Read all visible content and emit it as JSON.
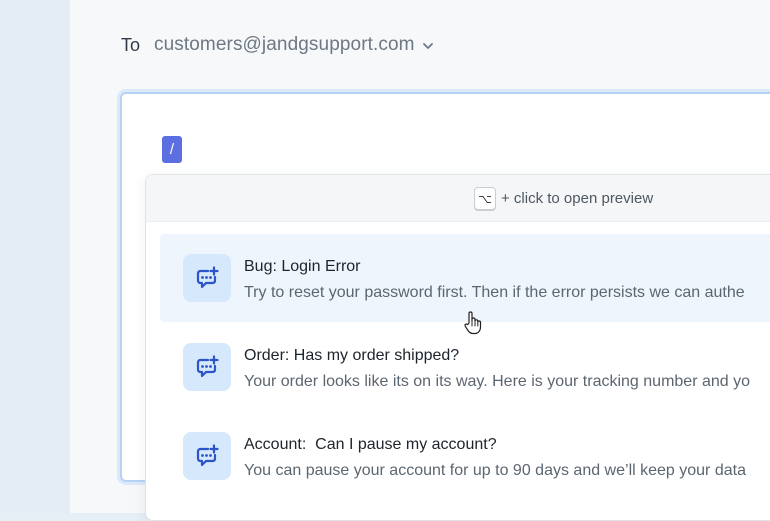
{
  "to": {
    "label": "To",
    "email": "customers@jandgsupport.com",
    "dropdown_icon": "chevron-down-icon"
  },
  "editor": {
    "slash_command": "/"
  },
  "popup": {
    "shortcut_key": "⌥",
    "hint": "+ click to open preview",
    "items": [
      {
        "title": "Bug: Login Error",
        "description": "Try to reset your password first. Then if the error persists we can authe",
        "icon": "chat-plus-icon",
        "active": true
      },
      {
        "title": "Order: Has my order shipped?",
        "description": "Your order looks like its on its way. Here is your tracking number and yo",
        "icon": "chat-plus-icon",
        "active": false
      },
      {
        "title": "Account:  Can I pause my account?",
        "description": "You can pause your account for up to 90 days and we’ll keep your data",
        "icon": "chat-plus-icon",
        "active": false
      }
    ]
  },
  "colors": {
    "accent": "#5b6fe0",
    "icon_bg": "#d6e8fb",
    "icon_fg": "#2b55c8",
    "active_row": "#eef5fc",
    "editor_border": "#b7d3f3"
  }
}
